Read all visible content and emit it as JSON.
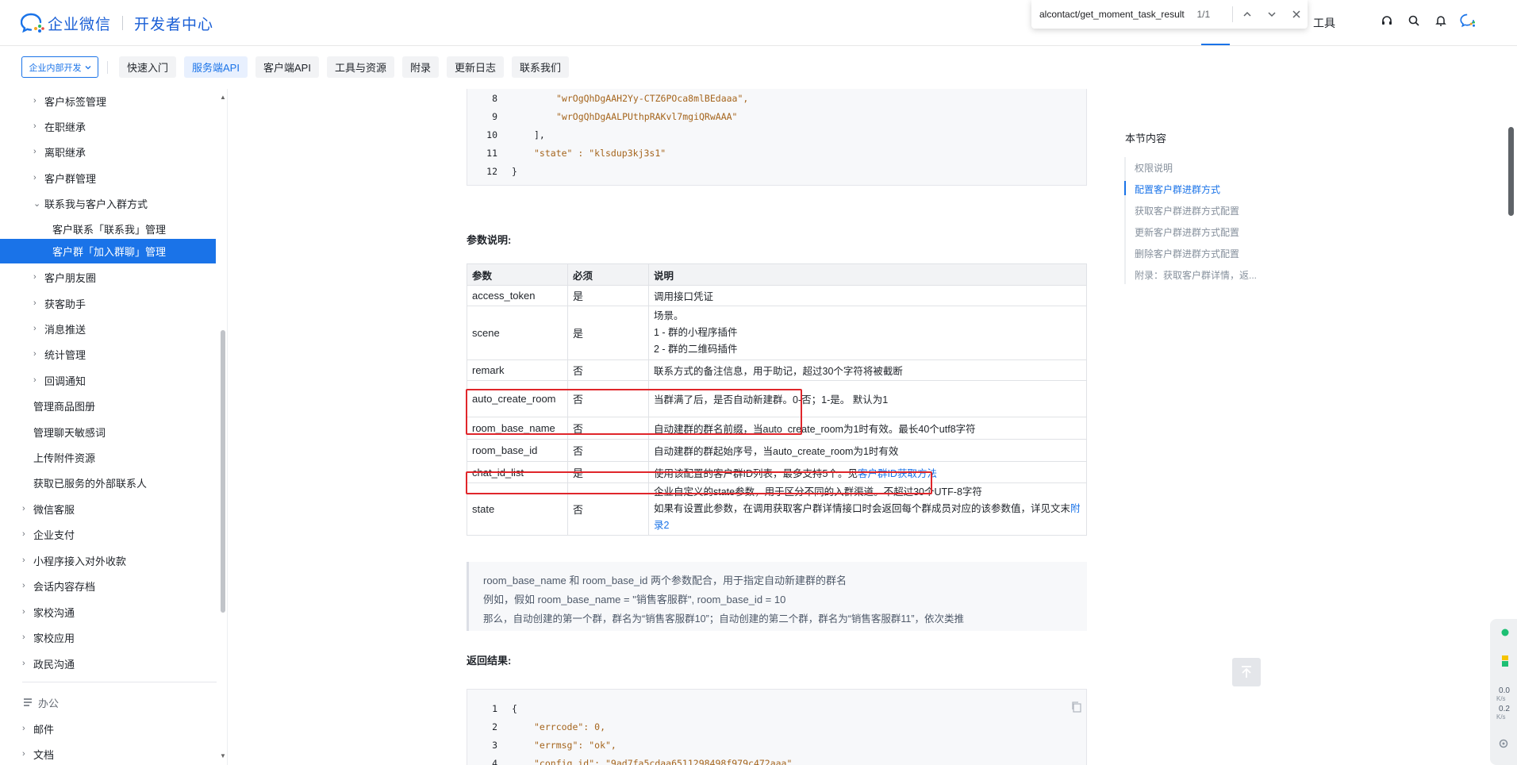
{
  "header": {
    "brand": "企业微信",
    "subtitle": "开发者中心",
    "tool_label": "工具",
    "find": {
      "query": "alcontact/get_moment_task_result",
      "count": "1/1"
    }
  },
  "navbar": {
    "dev_select": "企业内部开发",
    "tabs": [
      "快速入门",
      "服务端API",
      "客户端API",
      "工具与资源",
      "附录",
      "更新日志",
      "联系我们"
    ],
    "active_tab": "服务端API"
  },
  "sidebar": {
    "items": [
      {
        "label": "客户标签管理",
        "chev": "›"
      },
      {
        "label": "在职继承",
        "chev": "›"
      },
      {
        "label": "离职继承",
        "chev": "›"
      },
      {
        "label": "客户群管理",
        "chev": "›"
      },
      {
        "label": "联系我与客户入群方式",
        "chev": "⌄"
      },
      {
        "label": "客户联系「联系我」管理",
        "chev": ""
      },
      {
        "label": "客户群「加入群聊」管理",
        "chev": ""
      },
      {
        "label": "客户朋友圈",
        "chev": "›"
      },
      {
        "label": "获客助手",
        "chev": "›"
      },
      {
        "label": "消息推送",
        "chev": "›"
      },
      {
        "label": "统计管理",
        "chev": "›"
      },
      {
        "label": "回调通知",
        "chev": "›"
      },
      {
        "label": "管理商品图册",
        "chev": ""
      },
      {
        "label": "管理聊天敏感词",
        "chev": ""
      },
      {
        "label": "上传附件资源",
        "chev": ""
      },
      {
        "label": "获取已服务的外部联系人",
        "chev": ""
      },
      {
        "label": "微信客服",
        "chev": "›"
      },
      {
        "label": "企业支付",
        "chev": "›"
      },
      {
        "label": "小程序接入对外收款",
        "chev": "›"
      },
      {
        "label": "会话内容存档",
        "chev": "›"
      },
      {
        "label": "家校沟通",
        "chev": "›"
      },
      {
        "label": "家校应用",
        "chev": "›"
      },
      {
        "label": "政民沟通",
        "chev": "›"
      },
      {
        "label": "办公",
        "chev": ""
      },
      {
        "label": "邮件",
        "chev": "›"
      },
      {
        "label": "文档",
        "chev": "›"
      }
    ],
    "active": "客户群「加入群聊」管理"
  },
  "code_top": {
    "lines": [
      {
        "n": "8",
        "text": "\"wrOgQhDgAAH2Yy-CTZ6POca8mlBEdaaa\","
      },
      {
        "n": "9",
        "text": "\"wrOgQhDgAALPUthpRAKvl7mgiQRwAAA\""
      },
      {
        "n": "10",
        "text": "],"
      },
      {
        "n": "11",
        "text": "\"state\" : \"klsdup3kj3s1\""
      },
      {
        "n": "12",
        "text": "}"
      }
    ]
  },
  "params_title": "参数说明:",
  "params_table": {
    "headers": [
      "参数",
      "必须",
      "说明"
    ],
    "rows": [
      {
        "name": "access_token",
        "req": "是",
        "desc": "调用接口凭证"
      },
      {
        "name": "scene",
        "req": "是",
        "desc": "场景。\n1 - 群的小程序插件\n2 - 群的二维码插件"
      },
      {
        "name": "remark",
        "req": "否",
        "desc": "联系方式的备注信息，用于助记，超过30个字符将被截断"
      },
      {
        "name": "auto_create_room",
        "req": "否",
        "desc": "当群满了后，是否自动新建群。0-否；1-是。 默认为1"
      },
      {
        "name": "room_base_name",
        "req": "否",
        "desc": "自动建群的群名前缀，当auto_create_room为1时有效。最长40个utf8字符"
      },
      {
        "name": "room_base_id",
        "req": "否",
        "desc": "自动建群的群起始序号，当auto_create_room为1时有效"
      },
      {
        "name": "chat_id_list",
        "req": "是",
        "desc": "使用该配置的客户群ID列表，最多支持5个。见",
        "link": "客户群ID获取方法"
      },
      {
        "name": "state",
        "req": "否",
        "desc": "企业自定义的state参数，用于区分不同的入群渠道。不超过30个UTF-8字符\n如果有设置此参数，在调用获取客户群详情接口时会返回每个群成员对应的该参数值，详见文末",
        "link": "附录2"
      }
    ]
  },
  "note": {
    "line1": "room_base_name 和 room_base_id 两个参数配合，用于指定自动新建群的群名",
    "line2": "例如，假如 room_base_name = \"销售客服群\", room_base_id = 10",
    "line3": "那么，自动创建的第一个群，群名为“销售客服群10”；自动创建的第二个群，群名为“销售客服群11”，依次类推"
  },
  "return_title": "返回结果:",
  "code_bottom": {
    "lines": [
      {
        "n": "1",
        "text": "{"
      },
      {
        "n": "2",
        "text": "\"errcode\": 0,"
      },
      {
        "n": "3",
        "text": "\"errmsg\": \"ok\","
      },
      {
        "n": "4",
        "text": "\"config_id\": \"9ad7fa5cdaa6511298498f979c472aaa\""
      }
    ]
  },
  "toc": {
    "title": "本节内容",
    "items": [
      "权限说明",
      "配置客户群进群方式",
      "获取客户群进群方式配置",
      "更新客户群进群方式配置",
      "删除客户群进群方式配置",
      "附录：获取客户群详情，返..."
    ],
    "active": "配置客户群进群方式"
  },
  "widget": {
    "up": "0.0",
    "down": "0.2",
    "unit": "K/s"
  },
  "colors": {
    "accent": "#1a73e8",
    "highlight": "#e0262b"
  }
}
